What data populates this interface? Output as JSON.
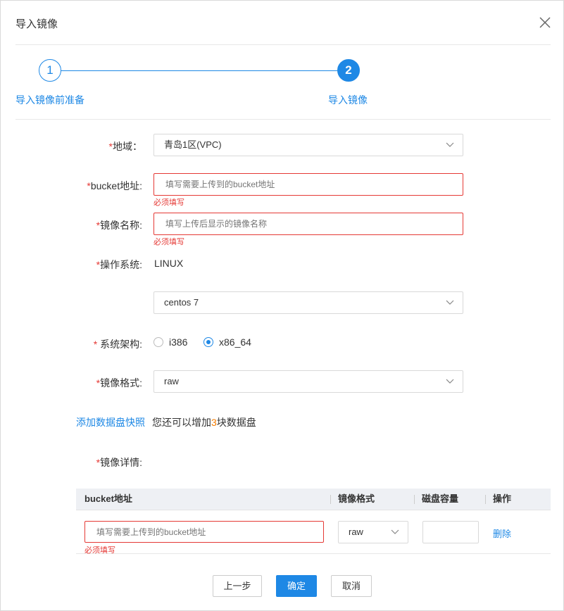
{
  "dialog": {
    "title": "导入镜像"
  },
  "steps": [
    {
      "number": "1",
      "label": "导入镜像前准备"
    },
    {
      "number": "2",
      "label": "导入镜像"
    }
  ],
  "form": {
    "region": {
      "required_mark": "*",
      "label": "地域：",
      "value": "青岛1区(VPC)"
    },
    "bucket": {
      "required_mark": "*",
      "label": "bucket地址:",
      "placeholder": "填写需要上传到的bucket地址",
      "error": "必须填写"
    },
    "image_name": {
      "required_mark": "*",
      "label": "镜像名称:",
      "placeholder": "填写上传后显示的镜像名称",
      "error": "必须填写"
    },
    "os": {
      "required_mark": "*",
      "label": "操作系统:",
      "family": "LINUX",
      "version": "centos 7"
    },
    "arch": {
      "required_mark": "* ",
      "label": "系统架构:",
      "options": [
        "i386",
        "x86_64"
      ],
      "selected": "x86_64"
    },
    "format": {
      "required_mark": "*",
      "label": "镜像格式:",
      "value": "raw"
    },
    "data_disk": {
      "link": "添加数据盘快照",
      "text_prefix": "您还可以增加",
      "count": "3",
      "text_suffix": "块数据盘"
    },
    "details": {
      "required_mark": "*",
      "label": "镜像详情:"
    }
  },
  "table": {
    "headers": [
      "bucket地址",
      "镜像格式",
      "磁盘容量",
      "操作"
    ],
    "row": {
      "bucket_placeholder": "填写需要上传到的bucket地址",
      "bucket_error": "必须填写",
      "format": "raw",
      "capacity": "",
      "action": "删除"
    }
  },
  "footer": {
    "prev": "上一步",
    "confirm": "确定",
    "cancel": "取消"
  },
  "colors": {
    "accent": "#1e88e5",
    "error": "#e53935",
    "highlight": "#f57c00"
  }
}
